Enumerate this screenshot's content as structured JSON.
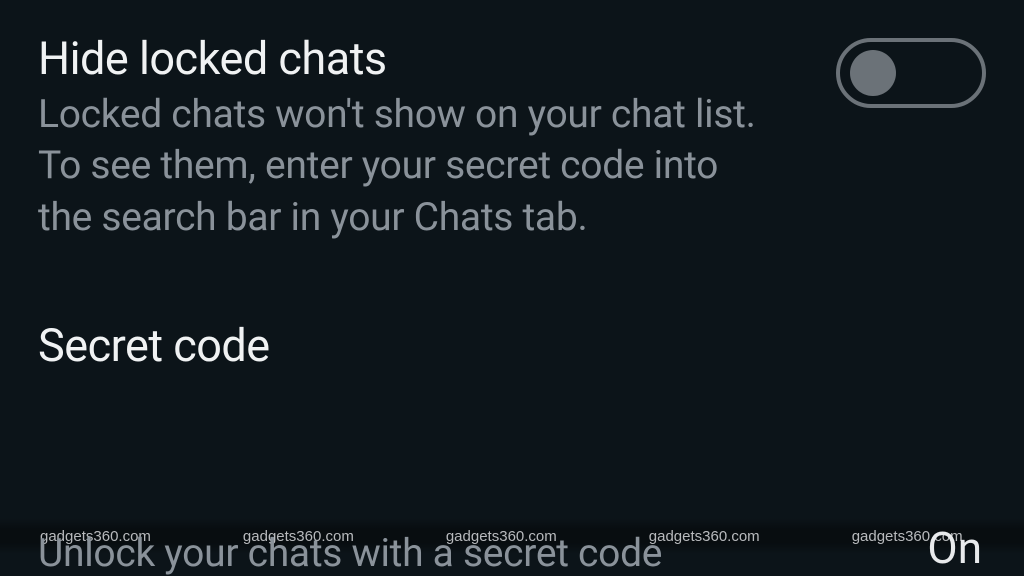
{
  "settings": {
    "hideLockedChats": {
      "title": "Hide locked chats",
      "description": "Locked chats won't show on your chat list. To see them, enter your secret code into the search bar in your Chats tab.",
      "enabled": false
    },
    "secretCode": {
      "title": "Secret code",
      "description": "Unlock your chats with a secret code",
      "status": "On"
    }
  },
  "watermark": {
    "text": "gadgets360.com",
    "repeatCount": 6
  }
}
